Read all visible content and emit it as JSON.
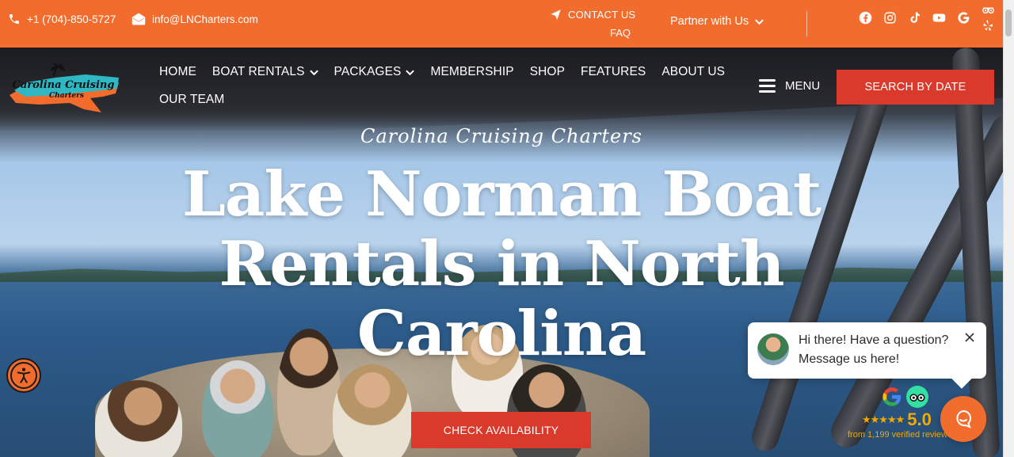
{
  "topbar": {
    "phone": "+1 (704)-850-5727",
    "email": "info@LNCharters.com",
    "contact_label": "CONTACT US",
    "faq_label": "FAQ",
    "partner_label": "Partner with Us",
    "socials": [
      "facebook-icon",
      "instagram-icon",
      "tiktok-icon",
      "youtube-icon",
      "google-icon",
      "tripadvisor-icon",
      "yelp-icon"
    ]
  },
  "logo": {
    "line1": "Carolina Cruising",
    "line2": "Charters"
  },
  "nav": {
    "row1": [
      {
        "label": "HOME"
      },
      {
        "label": "BOAT RENTALS",
        "dropdown": true
      },
      {
        "label": "PACKAGES",
        "dropdown": true
      },
      {
        "label": "MEMBERSHIP"
      },
      {
        "label": "SHOP"
      },
      {
        "label": "FEATURES"
      },
      {
        "label": "ABOUT US"
      }
    ],
    "row2": [
      {
        "label": "OUR TEAM"
      }
    ],
    "menu_label": "MENU",
    "search_label": "SEARCH BY DATE"
  },
  "hero": {
    "script_title": "Carolina Cruising Charters",
    "headline": "Lake Norman Boat Rentals in North Carolina",
    "cta_label": "CHECK AVAILABILITY"
  },
  "chat": {
    "line1": "Hi there! Have a question?",
    "line2": "Message us here!"
  },
  "reviews": {
    "stars": "★★★★★",
    "score": "5.0",
    "subtitle": "from 1,199 verified reviews"
  },
  "colors": {
    "brand_orange": "#f26d2d",
    "cta_red": "#d93a2b",
    "review_gold": "#f2a900"
  }
}
